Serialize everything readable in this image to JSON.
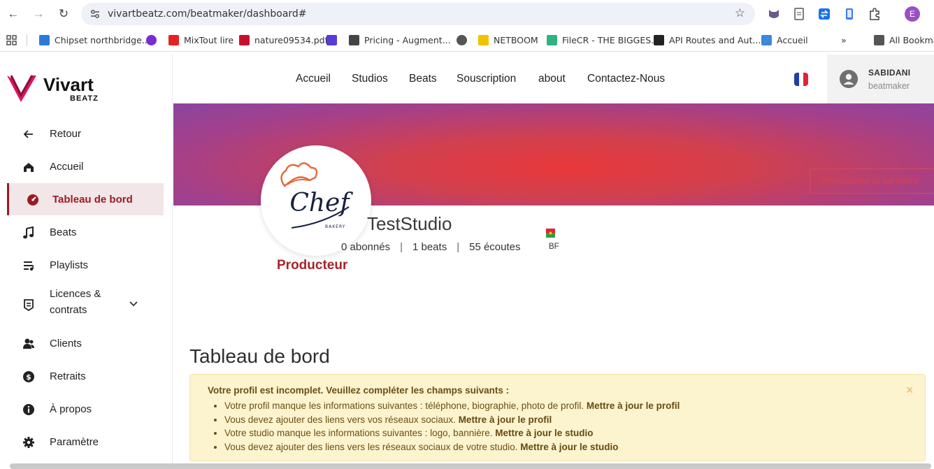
{
  "browser": {
    "url": "vivartbeatz.com/beatmaker/dashboard#",
    "profile_initial": "E",
    "bookmarks": [
      {
        "label": "Chipset northbridge...",
        "color": "#2b7bd6"
      },
      {
        "label": "",
        "color": "#7a2ad6"
      },
      {
        "label": "MixTout lire",
        "color": "#e52222"
      },
      {
        "label": "nature09534.pdf",
        "color": "#c8102e"
      },
      {
        "label": "",
        "color": "#5b3bd6"
      },
      {
        "label": "Pricing - Augment...",
        "color": "#444444"
      },
      {
        "label": "",
        "color": "#555555"
      },
      {
        "label": "NETBOOM",
        "color": "#f2c200"
      },
      {
        "label": "FileCR - THE BIGGES...",
        "color": "#2fb380"
      },
      {
        "label": "API Routes and Aut...",
        "color": "#222222"
      },
      {
        "label": "Accueil",
        "color": "#3c89d8"
      },
      {
        "label": "»",
        "color": ""
      },
      {
        "label": "All Bookmarks",
        "color": "#555555"
      }
    ]
  },
  "logo": {
    "brand": "Vivart",
    "sub": "BEATZ"
  },
  "sidebar": {
    "items": [
      {
        "label": "Retour",
        "icon": "arrow-left-icon"
      },
      {
        "label": "Accueil",
        "icon": "home-icon"
      },
      {
        "label": "Tableau de bord",
        "icon": "gauge-icon",
        "active": true
      },
      {
        "label": "Beats",
        "icon": "music-note-icon"
      },
      {
        "label": "Playlists",
        "icon": "playlist-icon"
      },
      {
        "label": "Licences &",
        "label2": "contrats",
        "icon": "license-icon"
      },
      {
        "label": "Clients",
        "icon": "users-icon"
      },
      {
        "label": "Retraits",
        "icon": "dollar-icon"
      },
      {
        "label": "À propos",
        "icon": "info-icon"
      },
      {
        "label": "Paramètre",
        "icon": "gear-icon"
      }
    ]
  },
  "topnav": {
    "links": [
      "Accueil",
      "Studios",
      "Beats",
      "Souscription",
      "about",
      "Contactez-Nous"
    ],
    "user_name": "SABIDANI",
    "user_role": "beatmaker"
  },
  "banner": {
    "reset_label": "Réinitialiser la bannière"
  },
  "studio": {
    "name": "TestStudio",
    "logo_text": "Chef",
    "logo_sub": "BAKERY",
    "subscribers": "0 abonnés",
    "beats": "1 beats",
    "listens": "55 écoutes",
    "country_code": "BF",
    "role": "Producteur"
  },
  "main": {
    "title": "Tableau de bord",
    "alert": {
      "heading": "Votre profil est incomplet. Veuillez compléter les champs suivants :",
      "items": [
        {
          "text": "Votre profil manque les informations suivantes : téléphone, biographie, photo de profil. ",
          "link": "Mettre à jour le profil"
        },
        {
          "text": "Vous devez ajouter des liens vers vos réseaux sociaux. ",
          "link": "Mettre à jour le profil"
        },
        {
          "text": "Votre studio manque les informations suivantes : logo, bannière. ",
          "link": "Mettre à jour le studio"
        },
        {
          "text": "Vous devez ajouter des liens vers les réseaux sociaux de votre studio. ",
          "link": "Mettre à jour le studio"
        }
      ],
      "close": "×"
    }
  },
  "colors": {
    "accent": "#9b1b22",
    "alert_bg": "#fcf3cf",
    "banner_center": "#e8383a",
    "banner_edge": "#8b44a0"
  }
}
